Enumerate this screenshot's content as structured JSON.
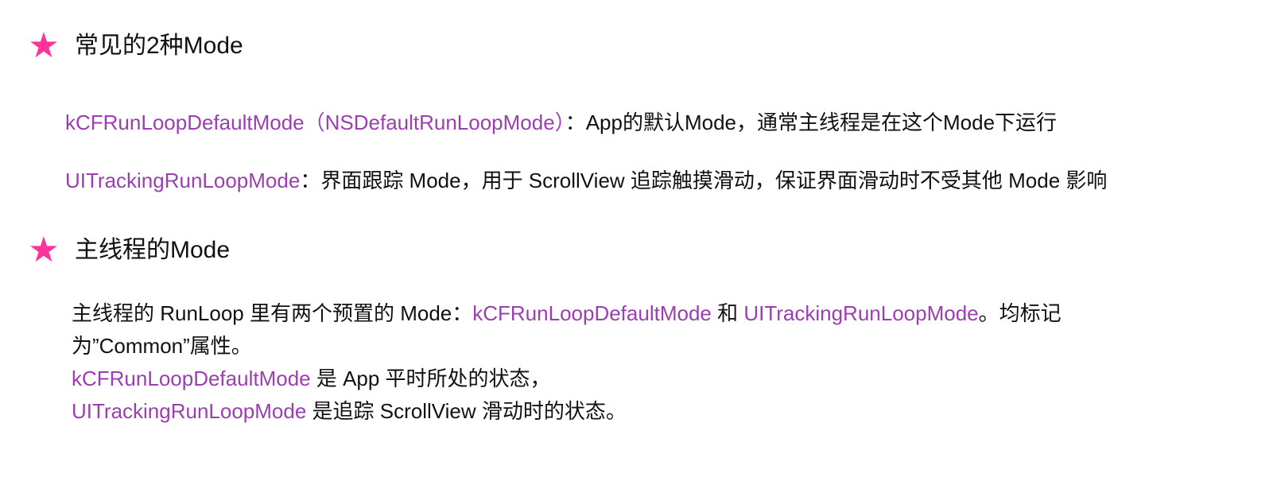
{
  "colors": {
    "star": "#ff3399",
    "highlight": "#9b3fb0",
    "text": "#111111"
  },
  "section1": {
    "icon": "star-icon",
    "title": "常见的2种Mode",
    "line1": {
      "mode": "kCFRunLoopDefaultMode（NSDefaultRunLoopMode）",
      "desc": "：App的默认Mode，通常主线程是在这个Mode下运行"
    },
    "line2": {
      "mode": "UITrackingRunLoopMode",
      "desc": "：界面跟踪 Mode，用于 ScrollView 追踪触摸滑动，保证界面滑动时不受其他 Mode 影响"
    }
  },
  "section2": {
    "icon": "star-icon",
    "title": "主线程的Mode",
    "para": {
      "row1_a": "主线程的 RunLoop 里有两个预置的 Mode：",
      "row1_mode1": "kCFRunLoopDefaultMode",
      "row1_b": " 和 ",
      "row1_mode2": "UITrackingRunLoopMode",
      "row1_c": "。均标记",
      "row2": "为”Common”属性。",
      "row3_mode": "kCFRunLoopDefaultMode",
      "row3_desc": " 是 App 平时所处的状态，",
      "row4_mode": "UITrackingRunLoopMode",
      "row4_desc": " 是追踪 ScrollView 滑动时的状态。"
    }
  }
}
